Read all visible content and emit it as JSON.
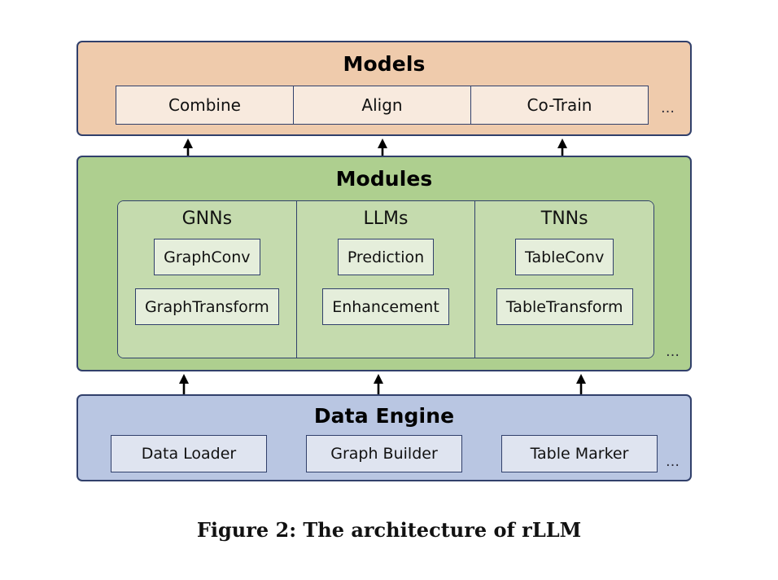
{
  "figure": {
    "caption": "Figure 2: The architecture of rLLM",
    "ellipsis": "…"
  },
  "colors": {
    "models_bg": "#efcbac",
    "models_cell_bg": "#f8eade",
    "modules_bg": "#aecf8f",
    "modules_group_bg": "#c5dbae",
    "modules_item_bg": "#e5eedb",
    "data_engine_bg": "#b9c6e2",
    "data_engine_cell_bg": "#dfe4f0",
    "border": "#31406b",
    "arrow": "#000000"
  },
  "models": {
    "title": "Models",
    "cells": [
      {
        "label": "Combine"
      },
      {
        "label": "Align"
      },
      {
        "label": "Co-Train"
      }
    ]
  },
  "modules": {
    "title": "Modules",
    "groups": [
      {
        "title": "GNNs",
        "items": [
          {
            "label": "GraphConv"
          },
          {
            "label": "GraphTransform"
          }
        ]
      },
      {
        "title": "LLMs",
        "items": [
          {
            "label": "Prediction"
          },
          {
            "label": "Enhancement"
          }
        ]
      },
      {
        "title": "TNNs",
        "items": [
          {
            "label": "TableConv"
          },
          {
            "label": "TableTransform"
          }
        ]
      }
    ]
  },
  "data_engine": {
    "title": "Data Engine",
    "cells": [
      {
        "label": "Data Loader"
      },
      {
        "label": "Graph Builder"
      },
      {
        "label": "Table Marker"
      }
    ]
  },
  "arrows": {
    "upper": [
      {
        "name": "arrow-modules-to-models-left"
      },
      {
        "name": "arrow-modules-to-models-center"
      },
      {
        "name": "arrow-modules-to-models-right"
      }
    ],
    "lower": [
      {
        "name": "arrow-dataengine-to-modules-left"
      },
      {
        "name": "arrow-dataengine-to-modules-center"
      },
      {
        "name": "arrow-dataengine-to-modules-right"
      }
    ]
  }
}
